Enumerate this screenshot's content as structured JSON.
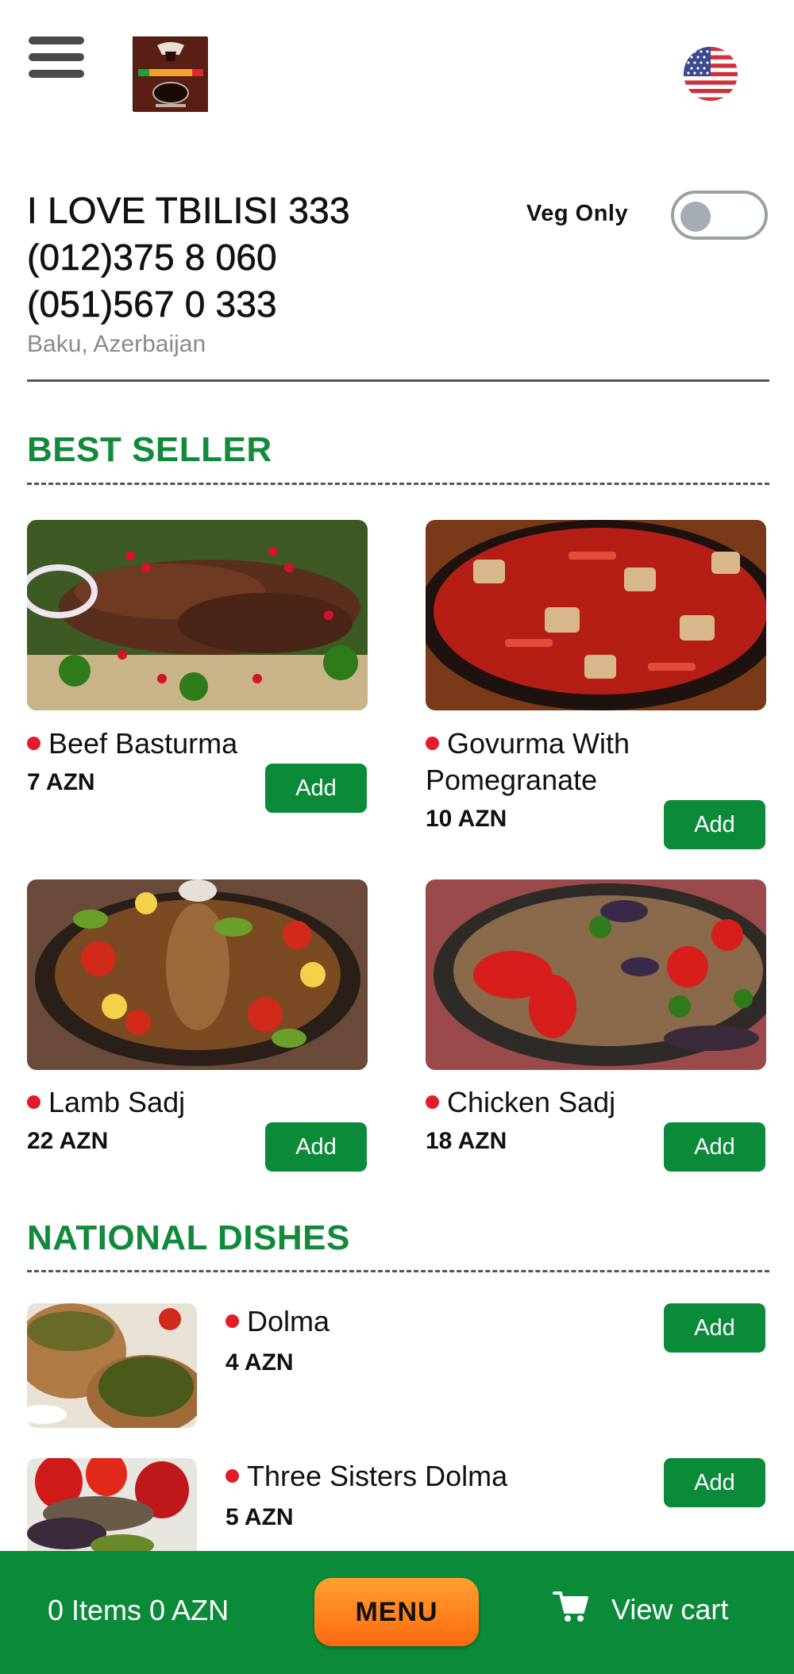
{
  "header": {
    "menu_icon": "hamburger-icon",
    "logo_icon": "restaurant-logo",
    "language_icon": "us-flag-icon"
  },
  "restaurant": {
    "name": "I LOVE TBILISI 333",
    "phone1": "(012)375 8 060",
    "phone2": "(051)567 0 333",
    "location": "Baku, Azerbaijan"
  },
  "veg_filter": {
    "label": "Veg Only",
    "enabled": false
  },
  "sections": [
    {
      "title": "BEST SELLER",
      "items": [
        {
          "name": "Beef Basturma",
          "price": "7 AZN",
          "add_label": "Add"
        },
        {
          "name": "Govurma With Pomegranate",
          "price": "10 AZN",
          "add_label": "Add"
        },
        {
          "name": "Lamb Sadj",
          "price": "22 AZN",
          "add_label": "Add"
        },
        {
          "name": "Chicken Sadj",
          "price": "18 AZN",
          "add_label": "Add"
        }
      ]
    },
    {
      "title": "NATIONAL DISHES",
      "items": [
        {
          "name": "Dolma",
          "price": "4 AZN",
          "add_label": "Add"
        },
        {
          "name": "Three Sisters Dolma",
          "price": "5 AZN",
          "add_label": "Add"
        }
      ]
    }
  ],
  "bottom_bar": {
    "cart_summary": "0 Items 0 AZN",
    "menu_label": "MENU",
    "view_cart_label": "View cart",
    "cart_icon": "cart-icon"
  },
  "colors": {
    "accent_green": "#0b8a3a",
    "section_green": "#118a3a",
    "menu_orange": "#ff8a1e",
    "veg_dot_red": "#e31b2a"
  }
}
